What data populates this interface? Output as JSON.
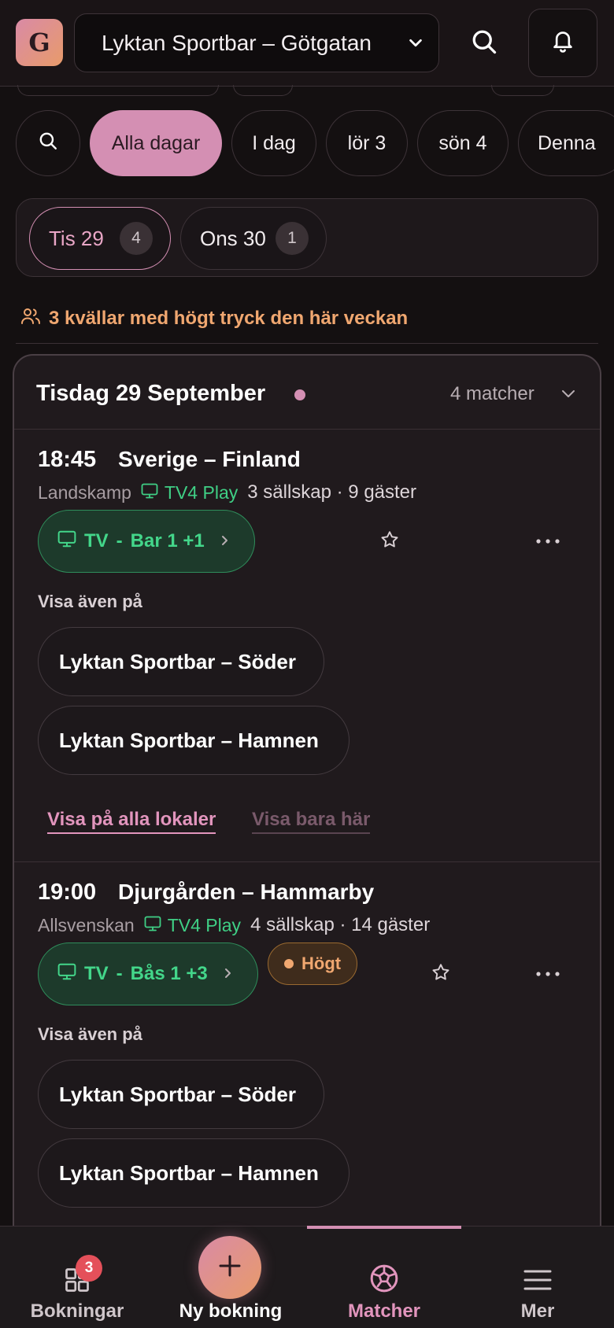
{
  "header": {
    "logo_letter": "G",
    "venue": "Lyktan Sportbar – Götgatan"
  },
  "filters": {
    "chips": [
      "Alla dagar",
      "I dag",
      "lör 3",
      "sön 4",
      "Denna"
    ]
  },
  "day_tabs": [
    {
      "label": "Tis 29",
      "count": "4"
    },
    {
      "label": "Ons 30",
      "count": "1"
    }
  ],
  "pressure_note": "3 kvällar med högt tryck den här veckan",
  "day_card": {
    "title": "Tisdag 29 September",
    "count_label": "4 matcher",
    "matches": [
      {
        "time": "18:45",
        "title": "Sverige – Finland",
        "league": "Landskamp",
        "channel": "TV4 Play",
        "stats": "3 sällskap · 9 gäster",
        "tv_label": "TV",
        "tv_sep": "-",
        "tv_target": "Bar 1 +1",
        "also_label": "Visa även på",
        "also_venues": [
          "Lyktan Sportbar – Söder",
          "Lyktan Sportbar – Hamnen"
        ],
        "link_all": "Visa på alla lokaler",
        "link_here": "Visa bara här"
      },
      {
        "time": "19:00",
        "title": "Djurgården – Hammarby",
        "league": "Allsvenskan",
        "channel": "TV4 Play",
        "stats": "4 sällskap · 14 gäster",
        "tv_label": "TV",
        "tv_sep": "-",
        "tv_target": "Bås 1 +3",
        "badge": "Högt",
        "also_label": "Visa även på",
        "also_venues": [
          "Lyktan Sportbar – Söder",
          "Lyktan Sportbar – Hamnen"
        ]
      }
    ]
  },
  "bottom_nav": {
    "items": [
      "Bokningar",
      "Ny bokning",
      "Matcher",
      "Mer"
    ],
    "bookings_badge": "3"
  },
  "colors": {
    "accent_pink": "#d48fb3",
    "accent_orange": "#f0a770",
    "tv_green": "#43d68a"
  }
}
